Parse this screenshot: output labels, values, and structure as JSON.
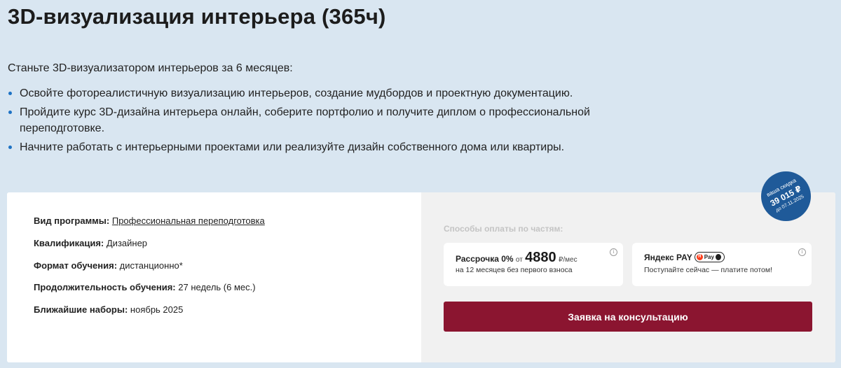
{
  "page": {
    "title": "3D-визуализация интерьера (365ч)",
    "intro": "Станьте 3D-визуализатором интерьеров за 6 месяцев:",
    "bullets": [
      "Освойте фотореалистичную визуализацию интерьеров, создание мудбордов и проектную документацию.",
      "Пройдите курс 3D-дизайна интерьера онлайн, соберите портфолио и получите диплом о профессиональной переподготовке.",
      "Начните работать с интерьерными проектами или реализуйте дизайн собственного дома или квартиры."
    ]
  },
  "program": {
    "type_label": "Вид программы:",
    "type_value": "Профессиональная переподготовка",
    "qualification_label": "Квалификация:",
    "qualification_value": "Дизайнер",
    "format_label": "Формат обучения:",
    "format_value": "дистанционно*",
    "duration_label": "Продолжительность обучения:",
    "duration_value": "27 недель (6 мес.)",
    "enrollment_label": "Ближайшие наборы:",
    "enrollment_value": "ноябрь 2025"
  },
  "payment": {
    "heading": "Способы оплаты по частям:",
    "installment": {
      "title": "Рассрочка 0%",
      "from": "от",
      "amount": "4880",
      "unit": "₽/мес",
      "subtitle": "на 12 месяцев без первого взноса",
      "info_icon": "i"
    },
    "yandex": {
      "title": "Яндекс PAY",
      "badge_letter": "Я",
      "badge_text": "Pay",
      "subtitle": "Поступайте сейчас — платите потом!",
      "info_icon": "i"
    },
    "cta_label": "Заявка на консультацию"
  },
  "discount": {
    "line1": "ваша скидка",
    "line2": "39 015 ₽",
    "line3": "до 07.11.2025"
  },
  "colors": {
    "background": "#d9e6f1",
    "accent_button": "#8b1530",
    "discount_badge": "#1f5a99",
    "bullet": "#1d72c4"
  }
}
